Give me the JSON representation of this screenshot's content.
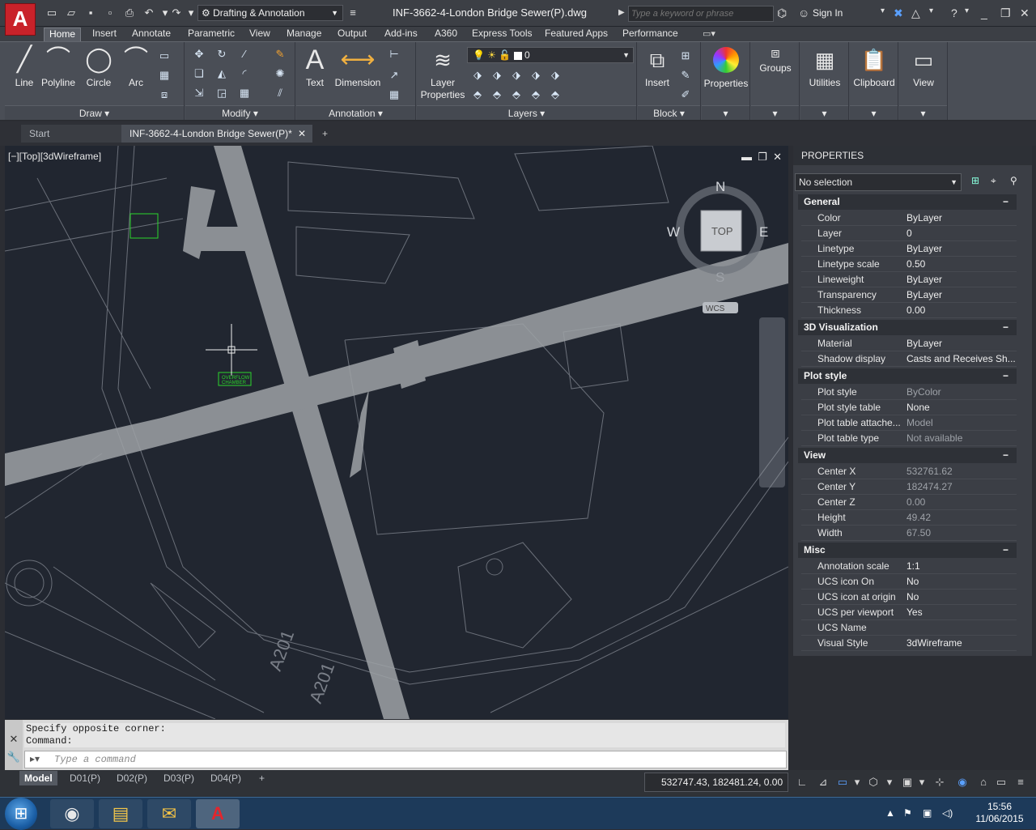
{
  "titlebar": {
    "workspace": "Drafting & Annotation",
    "document_title": "INF-3662-4-London Bridge Sewer(P).dwg",
    "search_placeholder": "Type a keyword or phrase",
    "sign_in": "Sign In"
  },
  "ribbon_tabs": [
    "Home",
    "Insert",
    "Annotate",
    "Parametric",
    "View",
    "Manage",
    "Output",
    "Add-ins",
    "A360",
    "Express Tools",
    "Featured Apps",
    "Performance"
  ],
  "ribbon": {
    "draw": {
      "title": "Draw",
      "buttons": [
        "Line",
        "Polyline",
        "Circle",
        "Arc"
      ]
    },
    "modify": {
      "title": "Modify"
    },
    "annotation": {
      "title": "Annotation",
      "buttons": [
        "Text",
        "Dimension"
      ]
    },
    "layers": {
      "title": "Layers",
      "layer_properties": "Layer Properties",
      "current_layer": "0"
    },
    "block": {
      "title": "Block",
      "insert": "Insert"
    },
    "properties_btn": "Properties",
    "groups_btn": "Groups",
    "utilities_btn": "Utilities",
    "clipboard_btn": "Clipboard",
    "view_btn": "View"
  },
  "doc_tabs": [
    "Start",
    "INF-3662-4-London Bridge Sewer(P)*"
  ],
  "viewport": {
    "label": "[−][Top][3dWireframe]",
    "viewcube": {
      "n": "N",
      "s": "S",
      "e": "E",
      "w": "W",
      "face": "TOP",
      "wcs": "WCS"
    },
    "labels": {
      "overflow1": "OVERFLOW",
      "overflow2": "CHAMBER",
      "road1": "A201",
      "road2": "A201"
    }
  },
  "properties": {
    "title": "PROPERTIES",
    "selection": "No selection",
    "sections": [
      {
        "name": "General",
        "rows": [
          [
            "Color",
            "ByLayer"
          ],
          [
            "Layer",
            "0"
          ],
          [
            "Linetype",
            "ByLayer"
          ],
          [
            "Linetype scale",
            "0.50"
          ],
          [
            "Lineweight",
            "ByLayer"
          ],
          [
            "Transparency",
            "ByLayer"
          ],
          [
            "Thickness",
            "0.00"
          ]
        ]
      },
      {
        "name": "3D Visualization",
        "rows": [
          [
            "Material",
            "ByLayer"
          ],
          [
            "Shadow display",
            "Casts and Receives Sh..."
          ]
        ]
      },
      {
        "name": "Plot style",
        "rows": [
          [
            "Plot style",
            "ByColor"
          ],
          [
            "Plot style table",
            "None"
          ],
          [
            "Plot table attache...",
            "Model"
          ],
          [
            "Plot table type",
            "Not available"
          ]
        ]
      },
      {
        "name": "View",
        "rows": [
          [
            "Center X",
            "532761.62"
          ],
          [
            "Center Y",
            "182474.27"
          ],
          [
            "Center Z",
            "0.00"
          ],
          [
            "Height",
            "49.42"
          ],
          [
            "Width",
            "67.50"
          ]
        ]
      },
      {
        "name": "Misc",
        "rows": [
          [
            "Annotation scale",
            "1:1"
          ],
          [
            "UCS icon On",
            "No"
          ],
          [
            "UCS icon at origin",
            "No"
          ],
          [
            "UCS per viewport",
            "Yes"
          ],
          [
            "UCS Name",
            ""
          ],
          [
            "Visual Style",
            "3dWireframe"
          ]
        ]
      }
    ]
  },
  "command": {
    "history1": "Specify opposite corner:",
    "history2": "Command:",
    "input_placeholder": "Type a command"
  },
  "layout_tabs": [
    "Model",
    "D01(P)",
    "D02(P)",
    "D03(P)",
    "D04(P)"
  ],
  "status": {
    "coords": "532747.43, 182481.24, 0.00"
  },
  "taskbar": {
    "time": "15:56",
    "date": "11/06/2015"
  }
}
